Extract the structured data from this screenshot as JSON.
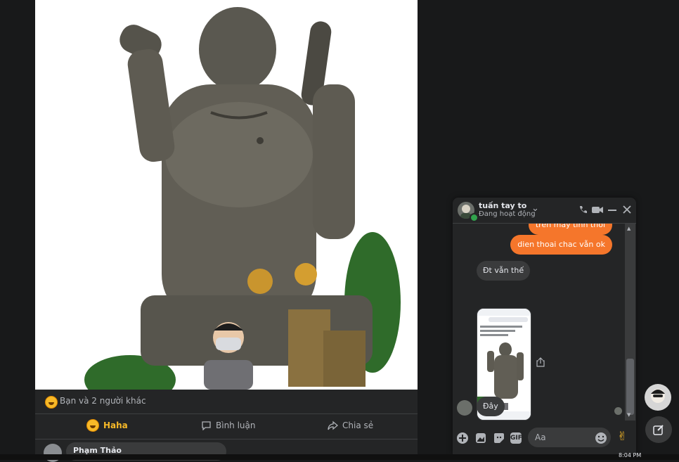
{
  "post": {
    "reaction_summary": "Bạn và 2 người khác",
    "actions": {
      "haha": "Haha",
      "comment": "Bình luận",
      "share": "Chia sẻ"
    },
    "comment_preview": {
      "author": "Phạm Thảo"
    }
  },
  "chat": {
    "contact_name": "tuấn tay to",
    "status": "Đang hoạt động",
    "messages": [
      {
        "from": "me",
        "text": "trên máy tính thôi"
      },
      {
        "from": "me",
        "text": "dien thoai chac vẫn ok"
      },
      {
        "from": "them",
        "text": "Đt vẫn thế"
      },
      {
        "from": "them",
        "text": "Đây"
      }
    ],
    "composer_placeholder": "Aa",
    "accent_color": "#f5762b",
    "icons": [
      "phone-icon",
      "video-icon",
      "minimize-icon",
      "close-icon",
      "plus-icon",
      "image-icon",
      "sticker-icon",
      "gif-icon",
      "emoji-icon",
      "peace-hand-icon"
    ]
  },
  "taskbar": {
    "time": "8:04 PM"
  }
}
